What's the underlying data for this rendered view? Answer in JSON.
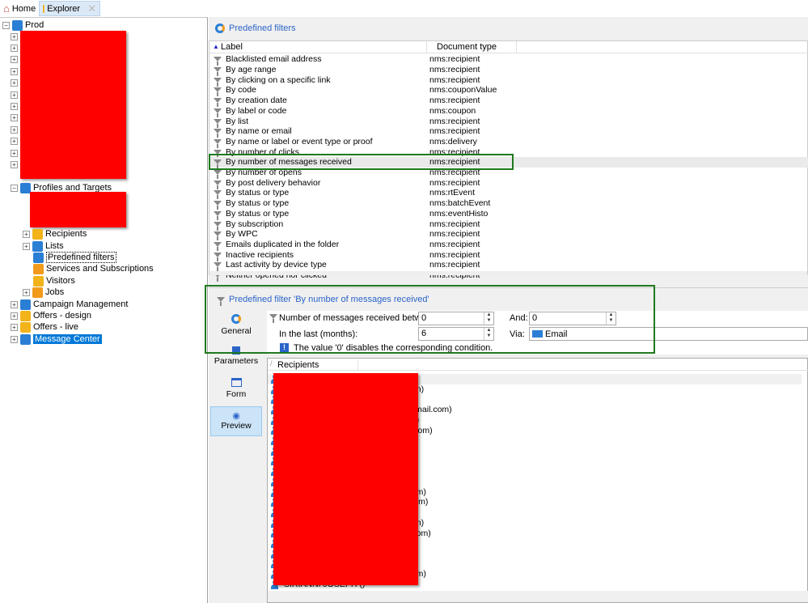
{
  "tabs": [
    {
      "label": "Home",
      "icon": "home-icon"
    },
    {
      "label": "Explorer",
      "icon": "folder-icon",
      "active": true
    }
  ],
  "tree": {
    "root": "Prod",
    "profiles": "Profiles and Targets",
    "profile_children": [
      "Recipients",
      "Lists",
      "Predefined filters",
      "Services and Subscriptions",
      "Visitors",
      "Jobs"
    ],
    "top_items": [
      "Campaign Management",
      "Offers - design",
      "Offers - live",
      "Message Center"
    ],
    "selected": "Message Center"
  },
  "panel": {
    "title": "Predefined filters",
    "columns": {
      "label": "Label",
      "doctype": "Document type"
    },
    "rows": [
      {
        "label": "Blacklisted email address",
        "type": "nms:recipient"
      },
      {
        "label": "By age range",
        "type": "nms:recipient"
      },
      {
        "label": "By clicking on a specific link",
        "type": "nms:recipient"
      },
      {
        "label": "By code",
        "type": "nms:couponValue"
      },
      {
        "label": "By creation date",
        "type": "nms:recipient"
      },
      {
        "label": "By label or code",
        "type": "nms:coupon"
      },
      {
        "label": "By list",
        "type": "nms:recipient"
      },
      {
        "label": "By name or email",
        "type": "nms:recipient"
      },
      {
        "label": "By name or label or event type or proof",
        "type": "nms:delivery"
      },
      {
        "label": "By number of clicks",
        "type": "nms:recipient"
      },
      {
        "label": "By number of messages received",
        "type": "nms:recipient"
      },
      {
        "label": "By number of opens",
        "type": "nms:recipient"
      },
      {
        "label": "By post delivery behavior",
        "type": "nms:recipient"
      },
      {
        "label": "By status or type",
        "type": "nms:rtEvent"
      },
      {
        "label": "By status or type",
        "type": "nms:batchEvent"
      },
      {
        "label": "By status or type",
        "type": "nms:eventHisto"
      },
      {
        "label": "By subscription",
        "type": "nms:recipient"
      },
      {
        "label": "By WPC",
        "type": "nms:recipient"
      },
      {
        "label": "Emails duplicated in the folder",
        "type": "nms:recipient"
      },
      {
        "label": "Inactive recipients",
        "type": "nms:recipient"
      },
      {
        "label": "Last activity by device type",
        "type": "nms:recipient"
      },
      {
        "label": "Neither opened nor clicked",
        "type": "nms:recipient"
      }
    ]
  },
  "detail": {
    "title": "Predefined filter 'By number of messages received'",
    "side_tabs": [
      "General",
      "Parameters",
      "Form",
      "Preview"
    ],
    "active_side_tab": "Preview",
    "messages_between_label": "Number of messages received between:",
    "messages_between_value": "0",
    "and_label": "And:",
    "and_value": "0",
    "last_months_label": "In the last (months):",
    "last_months_value": "6",
    "via_label": "Via:",
    "via_value": "Email",
    "info": "The value '0' disables the corresponding condition.",
    "preview_column": "Recipients",
    "preview_fragments": [
      {
        "row": 1,
        "text": "om)"
      },
      {
        "row": 3,
        "text": "na@gmail.com)"
      },
      {
        "row": 4,
        "text": "m)"
      },
      {
        "row": 5,
        "text": "l.com)"
      },
      {
        "row": 11,
        "text": "il.com)"
      },
      {
        "row": 12,
        "text": "com)"
      },
      {
        "row": 14,
        "text": "om)"
      },
      {
        "row": 15,
        "text": "ail.com)"
      },
      {
        "row": 19,
        "text": "il.com)"
      },
      {
        "row": 20,
        "text": "SIRIANNI JOSEPH ()"
      }
    ]
  },
  "colors": {
    "accent": "#0078d7",
    "highlight_box": "#1e7a1e",
    "redaction": "#ff0000",
    "link": "#2a64c8"
  }
}
